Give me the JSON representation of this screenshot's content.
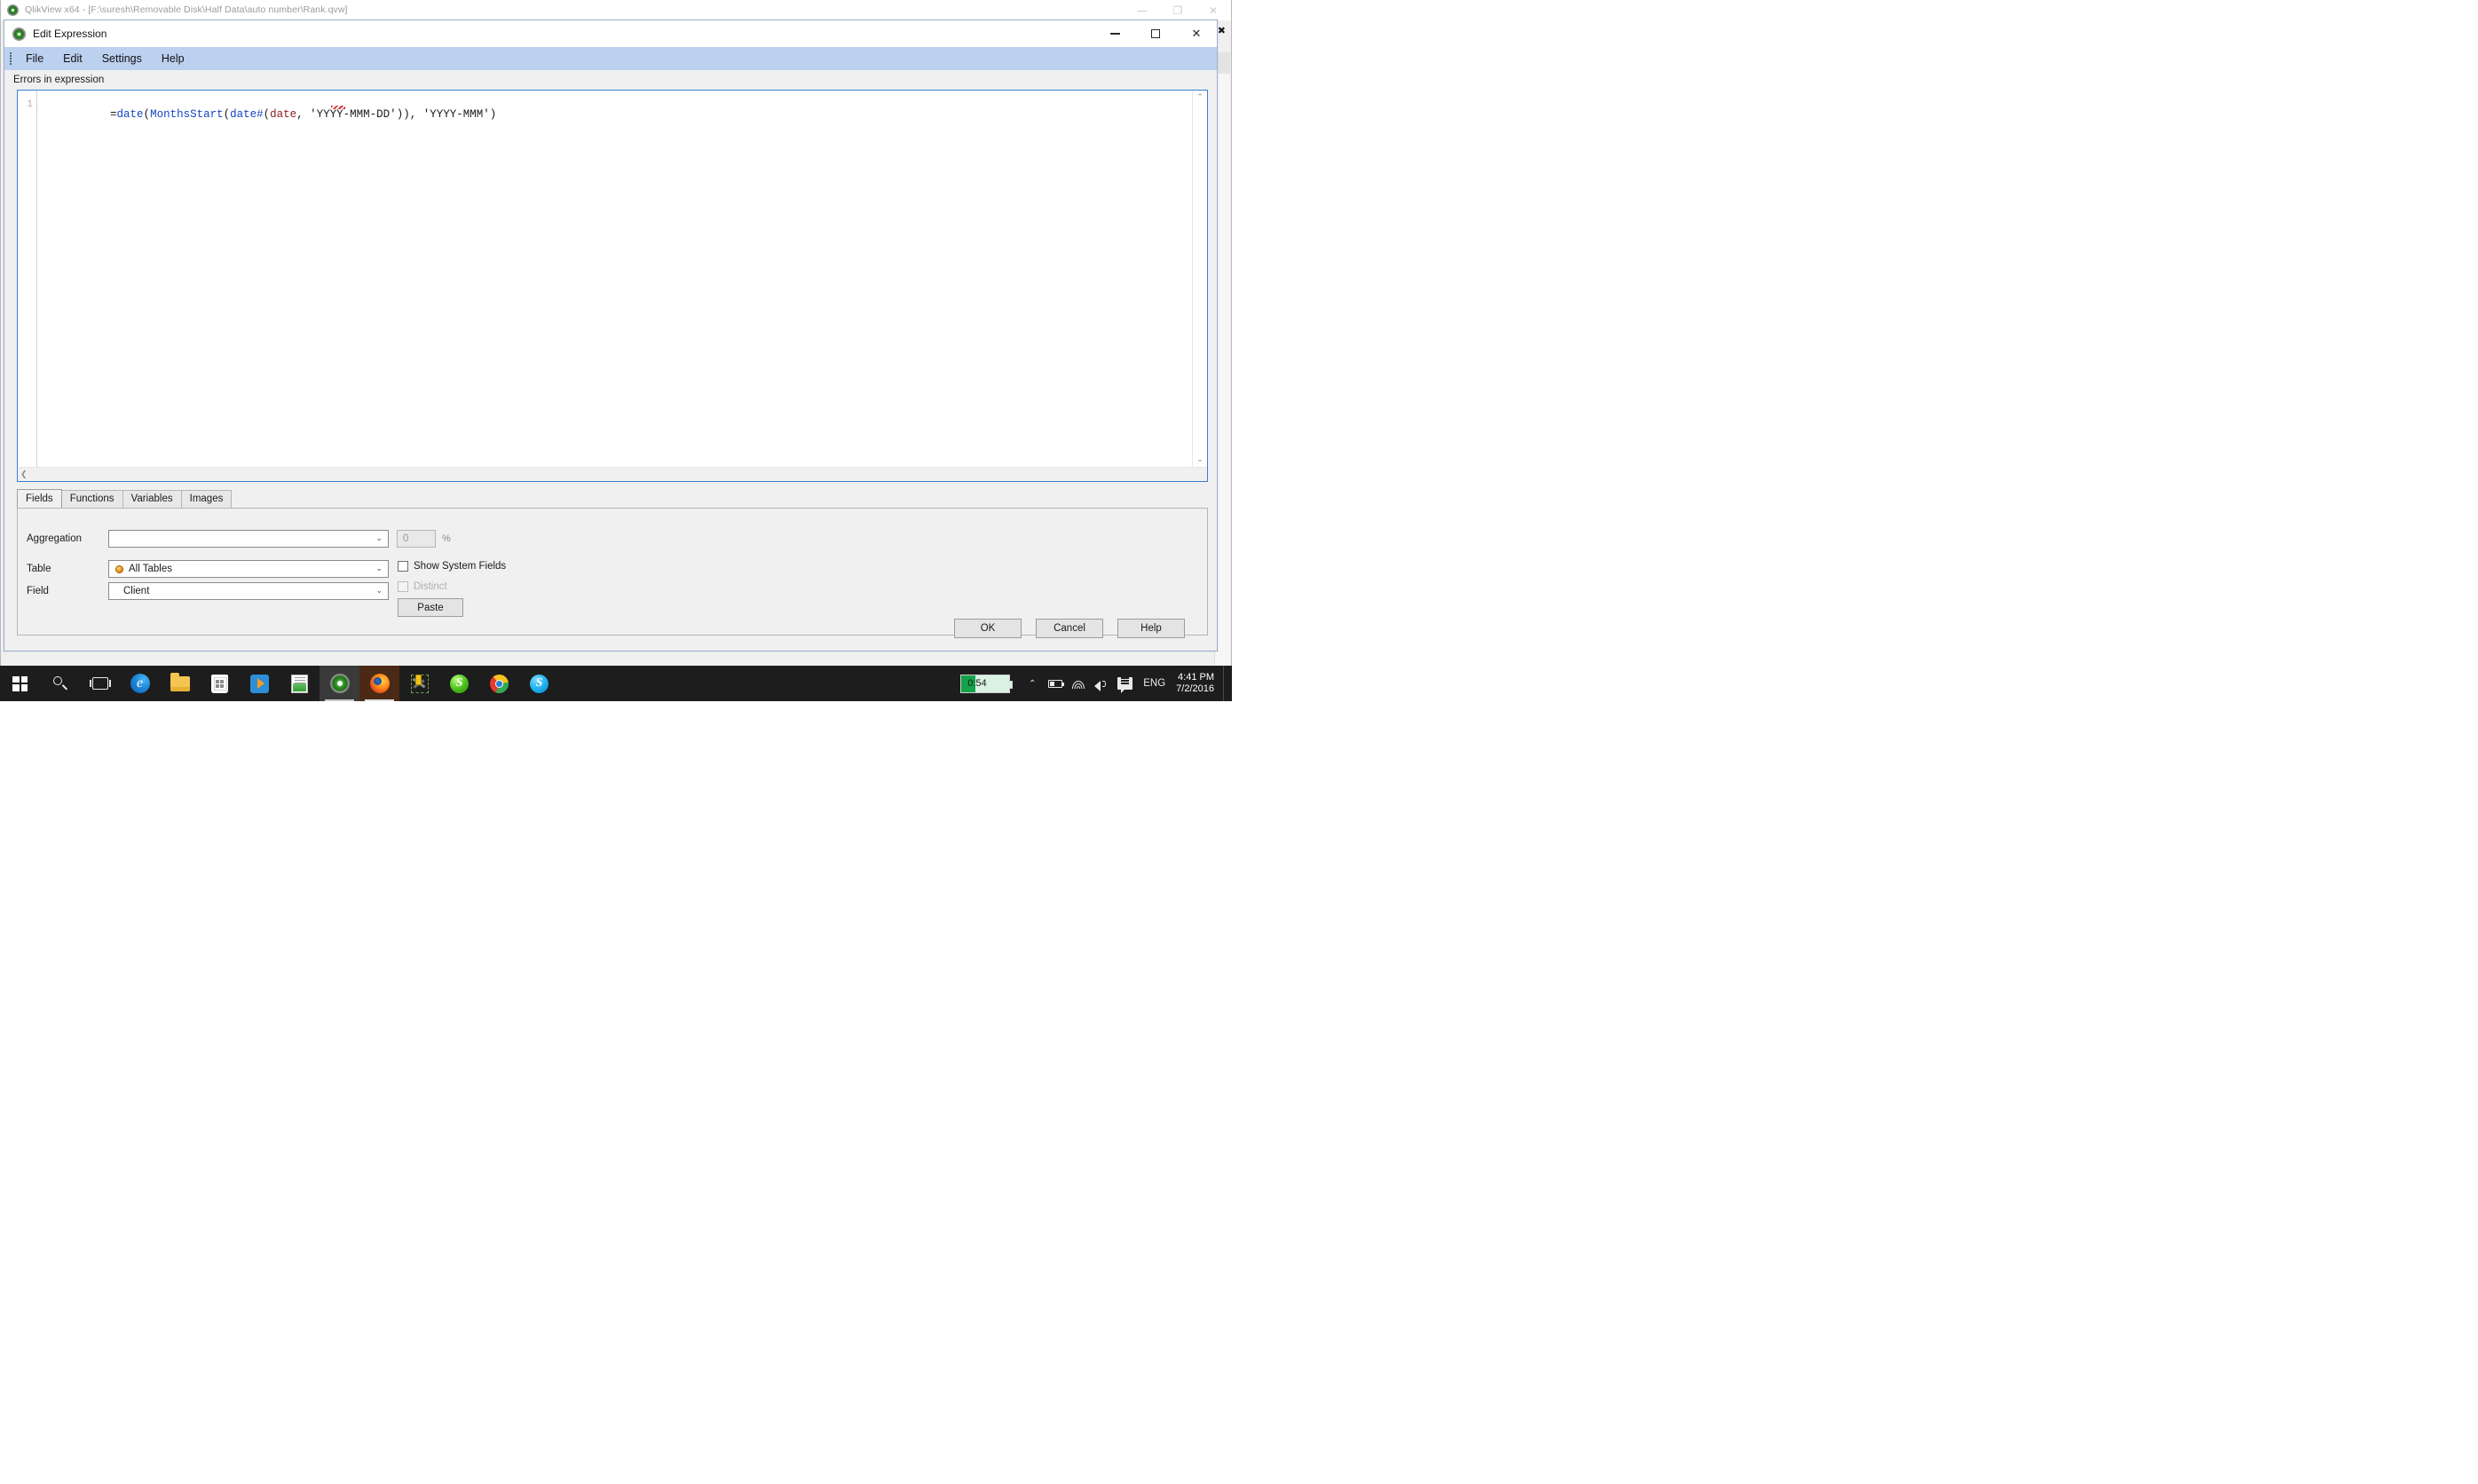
{
  "main_window": {
    "title": "QlikView x64 - [F:\\suresh\\Removable Disk\\Half Data\\auto number\\Rank.qvw]",
    "logo_icon": "qlikview-logo-icon",
    "minimize_label": "—",
    "maximize_label": "❐",
    "close_label": "✕",
    "mdi_restore_label": "❐",
    "mdi_close_label": "✖"
  },
  "dialog": {
    "title": "Edit Expression",
    "logo_icon": "qlikview-logo-icon",
    "minimize_label": "—",
    "maximize_label": "□",
    "close_label": "✕",
    "menu": [
      {
        "label": "File"
      },
      {
        "label": "Edit"
      },
      {
        "label": "Settings"
      },
      {
        "label": "Help"
      }
    ],
    "errors_label": "Errors in expression",
    "editor": {
      "line_number": "1",
      "expression": "=date(MonthsStart(date#(date, 'YYYY-MMM-DD')), 'YYYY-MMM')",
      "tokens": [
        {
          "text": "=",
          "kind": "operator"
        },
        {
          "text": "date",
          "kind": "function"
        },
        {
          "text": "(",
          "kind": "paren"
        },
        {
          "text": "MonthsStart",
          "kind": "function"
        },
        {
          "text": "(",
          "kind": "paren"
        },
        {
          "text": "date#",
          "kind": "function"
        },
        {
          "text": "(",
          "kind": "paren"
        },
        {
          "text": "date",
          "kind": "field"
        },
        {
          "text": ", ",
          "kind": "plain"
        },
        {
          "text": "'YYYY-MMM-DD'",
          "kind": "string"
        },
        {
          "text": "))",
          "kind": "paren"
        },
        {
          "text": ", ",
          "kind": "plain"
        },
        {
          "text": "'YYYY-MMM'",
          "kind": "string"
        },
        {
          "text": ")",
          "kind": "paren"
        }
      ],
      "scroll_up_label": "⌃",
      "scroll_down_label": "⌄",
      "scroll_left_label": "❮",
      "scroll_right_label": "❯"
    },
    "tabs": [
      {
        "label": "Fields",
        "active": true
      },
      {
        "label": "Functions",
        "active": false
      },
      {
        "label": "Variables",
        "active": false
      },
      {
        "label": "Images",
        "active": false
      }
    ],
    "fields_panel": {
      "aggregation_label": "Aggregation",
      "aggregation_value": "",
      "aggregation_placeholder": "",
      "percent_value": "0",
      "percent_symbol": "%",
      "table_label": "Table",
      "table_value": "All Tables",
      "table_icon": "orange-circle-icon",
      "field_label": "Field",
      "field_value": "Client",
      "show_system_fields_label": "Show System Fields",
      "show_system_fields_checked": false,
      "distinct_label": "Distinct",
      "distinct_checked": false,
      "distinct_disabled": true,
      "paste_label": "Paste",
      "dropdown_arrow": "⌄"
    },
    "footer": {
      "ok_label": "OK",
      "cancel_label": "Cancel",
      "help_label": "Help"
    }
  },
  "taskbar": {
    "items": [
      {
        "name": "start-button",
        "icon": "windows-start-icon"
      },
      {
        "name": "search-button",
        "icon": "search-icon"
      },
      {
        "name": "task-view-button",
        "icon": "task-view-icon"
      },
      {
        "name": "edge-button",
        "icon": "edge-icon"
      },
      {
        "name": "file-explorer-button",
        "icon": "folder-icon"
      },
      {
        "name": "store-button",
        "icon": "store-icon"
      },
      {
        "name": "movies-tv-button",
        "icon": "movies-play-icon"
      },
      {
        "name": "notepad-button",
        "icon": "notepad-icon"
      },
      {
        "name": "qlikview-button",
        "icon": "qlikview-logo-icon"
      },
      {
        "name": "firefox-button",
        "icon": "firefox-icon"
      },
      {
        "name": "tools-button",
        "icon": "tools-icon"
      },
      {
        "name": "skype-green-button",
        "icon": "skype-green-icon"
      },
      {
        "name": "chrome-button",
        "icon": "chrome-icon"
      },
      {
        "name": "skype-button",
        "icon": "skype-icon"
      }
    ],
    "tray": {
      "battery_widget_value": "0:54",
      "show_hidden_icons_label": "⌃",
      "battery_icon": "battery-icon",
      "network_icon": "wifi-icon",
      "volume_icon": "volume-icon",
      "action_center_icon": "action-center-icon",
      "language": "ENG",
      "time": "4:41 PM",
      "date": "7/2/2016"
    }
  },
  "colors": {
    "menu_bar": "#bcd0ef",
    "editor_border": "#3b7fd4",
    "function_text": "#1642c8",
    "field_text": "#8b1a1a",
    "dialog_bg": "#f0f0f0",
    "taskbar_bg": "#1d1d1d",
    "table_icon": "#f0a01e",
    "status_ok": "#36c53d"
  }
}
